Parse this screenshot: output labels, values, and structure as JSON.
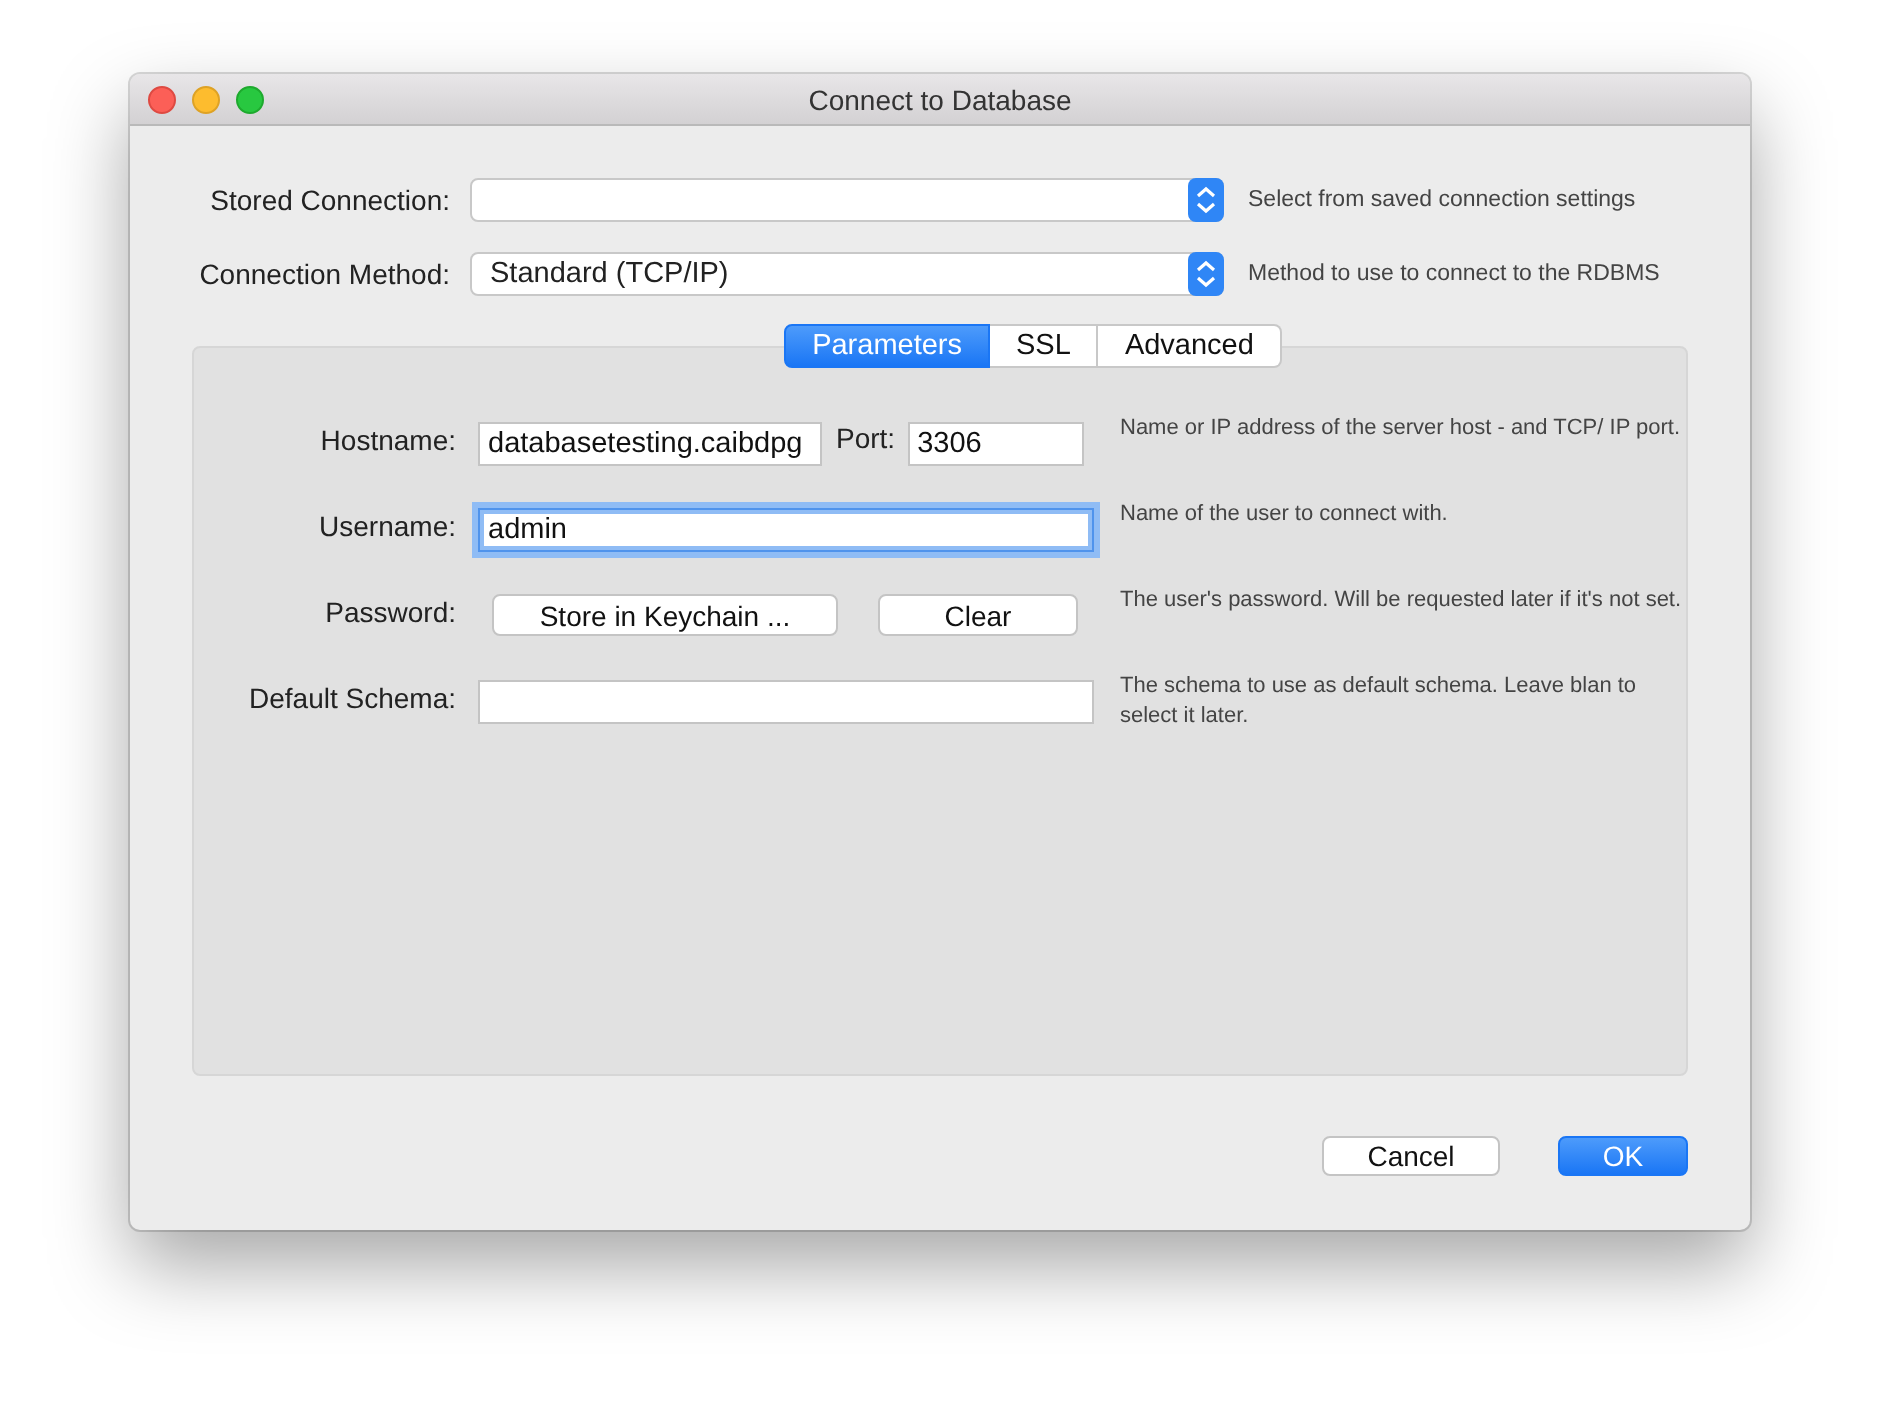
{
  "window": {
    "title": "Connect to Database"
  },
  "top_rows": [
    {
      "label": "Stored Connection:",
      "help": "Select from saved connection settings"
    },
    {
      "label": "Connection Method:",
      "value": "Standard (TCP/IP)",
      "help": "Method to use to connect to the RDBMS"
    }
  ],
  "tabs": [
    {
      "label": "Parameters",
      "selected": true
    },
    {
      "label": "SSL",
      "selected": false
    },
    {
      "label": "Advanced",
      "selected": false
    }
  ],
  "parameters": [
    {
      "kind": "host",
      "label": "Hostname:",
      "value": "databasetesting.caibdpg",
      "port_label": "Port:",
      "port_value": "3306",
      "help": "Name or IP address of the server host - and TCP/ IP port."
    },
    {
      "kind": "text",
      "label": "Username:",
      "value": "admin",
      "focused": true,
      "help": "Name of the user to connect with."
    },
    {
      "kind": "password",
      "label": "Password:",
      "buttons": [
        "Store in Keychain ...",
        "Clear"
      ],
      "help": "The user's password. Will be requested later if it's not set."
    },
    {
      "kind": "text",
      "label": "Default Schema:",
      "focused": false,
      "help": "The schema to use as default schema. Leave blan to select it later."
    }
  ],
  "buttons": [
    {
      "label": "Cancel",
      "kind": "secondary"
    },
    {
      "label": "OK",
      "kind": "primary"
    }
  ]
}
